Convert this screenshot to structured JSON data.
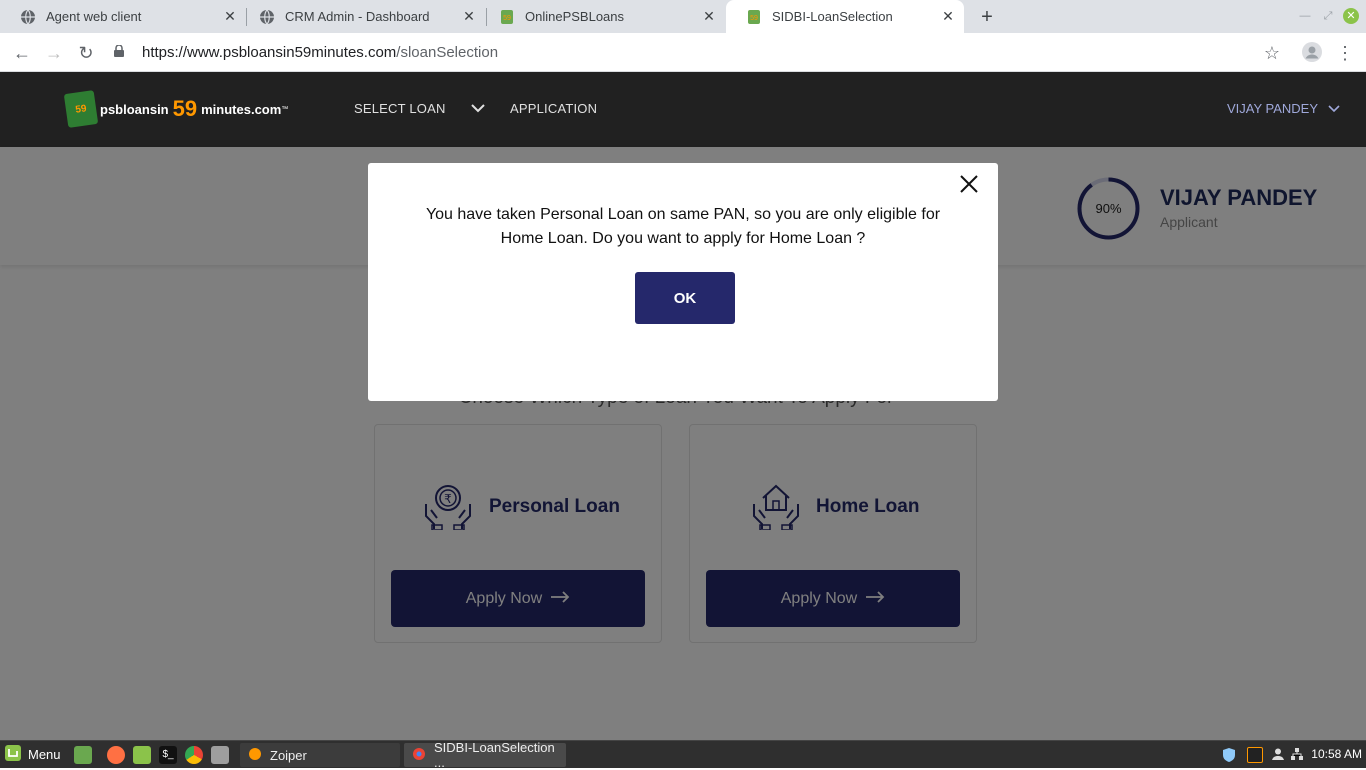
{
  "browser": {
    "tabs": [
      {
        "title": "Agent web client",
        "active": false
      },
      {
        "title": "CRM Admin - Dashboard",
        "active": false
      },
      {
        "title": "OnlinePSBLoans",
        "active": false
      },
      {
        "title": "SIDBI-LoanSelection",
        "active": true
      }
    ],
    "new_tab_icon": "plus-icon",
    "url_host": "https://www.psbloansin59minutes.com",
    "url_path": "/sloanSelection"
  },
  "site": {
    "logo": {
      "part1": "psbloansin",
      "part2": "59",
      "part3": "minutes.com",
      "tm": "™",
      "badge": "59"
    },
    "nav": {
      "select_loan": "SELECT LOAN",
      "application": "APPLICATION"
    },
    "user_menu": "VIJAY PANDEY"
  },
  "profile": {
    "progress_text": "90%",
    "progress_value": 0.9,
    "name": "VIJAY PANDEY",
    "role": "Applicant"
  },
  "loan_selection": {
    "heading": "Choose Which Type of Loan You Want To Apply For",
    "cards": [
      {
        "title": "Personal Loan",
        "icon": "rupee-hands-icon",
        "button": "Apply Now"
      },
      {
        "title": "Home Loan",
        "icon": "house-hands-icon",
        "button": "Apply Now"
      }
    ]
  },
  "modal": {
    "message": "You have taken Personal Loan on same PAN, so you are only eligible for Home Loan. Do you want to apply for Home Loan ?",
    "ok_label": "OK"
  },
  "taskbar": {
    "menu_label": "Menu",
    "tasks": [
      {
        "label": "Zoiper"
      },
      {
        "label": "SIDBI-LoanSelection ..."
      }
    ],
    "clock": "10:58 AM"
  },
  "colors": {
    "brand_navy": "#25286b",
    "header_bg": "#212121",
    "accent_orange": "#ff9800"
  }
}
